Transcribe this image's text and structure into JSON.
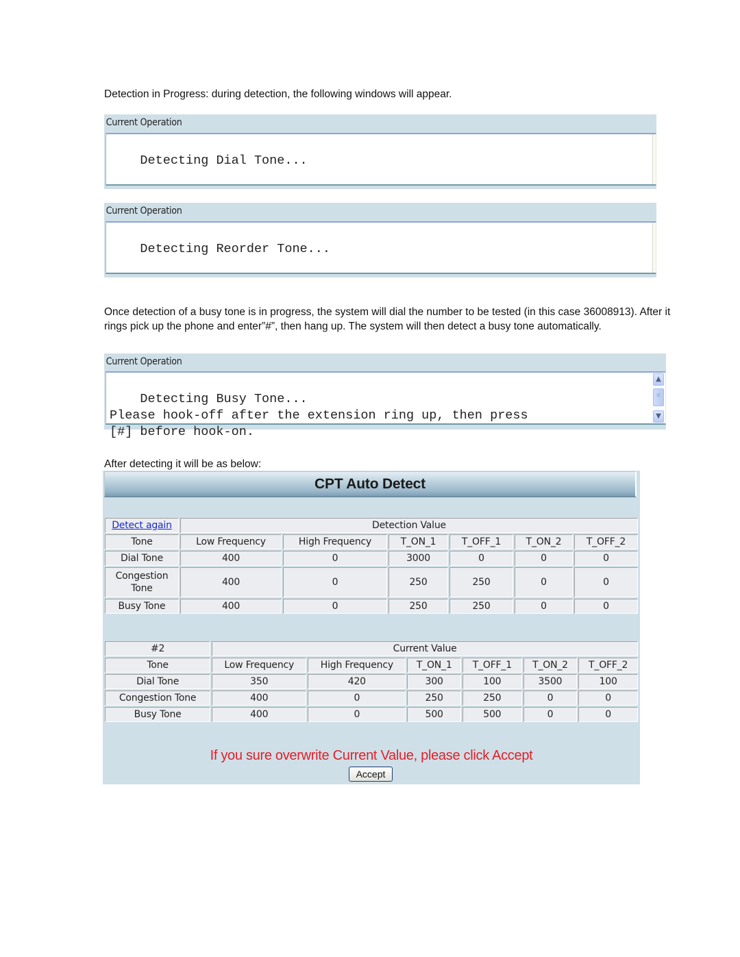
{
  "paragraphs": {
    "intro": "Detection in Progress: during detection, the following windows will appear.",
    "busy_note": "Once detection of a busy tone is in progress, the system will dial the number to be tested (in this case 36008913). After it rings pick up the phone and enter”#”, then hang up. The system will then detect a busy tone automatically.",
    "after": "After detecting it will be as below:"
  },
  "operations": [
    {
      "title": "Current Operation",
      "text": "Detecting Dial Tone..."
    },
    {
      "title": "Current Operation",
      "text": "Detecting Reorder Tone..."
    },
    {
      "title": "Current Operation",
      "text": "Detecting Busy Tone...\nPlease hook-off after the extension ring up, then press\n[#] before hook-on."
    }
  ],
  "scrollbar_icons": {
    "up": "scroll-up-arrow-icon",
    "thumb": "scroll-thumb-grip-icon",
    "down": "scroll-down-arrow-icon"
  },
  "cpt": {
    "title": "CPT Auto Detect",
    "detect_again": "Detect again",
    "detection_table": {
      "group_header": "Detection Value",
      "columns": [
        "Tone",
        "Low Frequency",
        "High Frequency",
        "T_ON_1",
        "T_OFF_1",
        "T_ON_2",
        "T_OFF_2"
      ],
      "rows": [
        [
          "Dial Tone",
          "400",
          "0",
          "3000",
          "0",
          "0",
          "0"
        ],
        [
          "Congestion Tone",
          "400",
          "0",
          "250",
          "250",
          "0",
          "0"
        ],
        [
          "Busy Tone",
          "400",
          "0",
          "250",
          "250",
          "0",
          "0"
        ]
      ]
    },
    "current_table": {
      "label": "#2",
      "group_header": "Current Value",
      "columns": [
        "Tone",
        "Low Frequency",
        "High Frequency",
        "T_ON_1",
        "T_OFF_1",
        "T_ON_2",
        "T_OFF_2"
      ],
      "rows": [
        [
          "Dial Tone",
          "350",
          "420",
          "300",
          "100",
          "3500",
          "100"
        ],
        [
          "Congestion Tone",
          "400",
          "0",
          "250",
          "250",
          "0",
          "0"
        ],
        [
          "Busy Tone",
          "400",
          "0",
          "500",
          "500",
          "0",
          "0"
        ]
      ]
    },
    "warning": "If you sure overwrite Current Value, please click Accept",
    "warning_color": "#e0202a",
    "accept_label": "Accept"
  }
}
